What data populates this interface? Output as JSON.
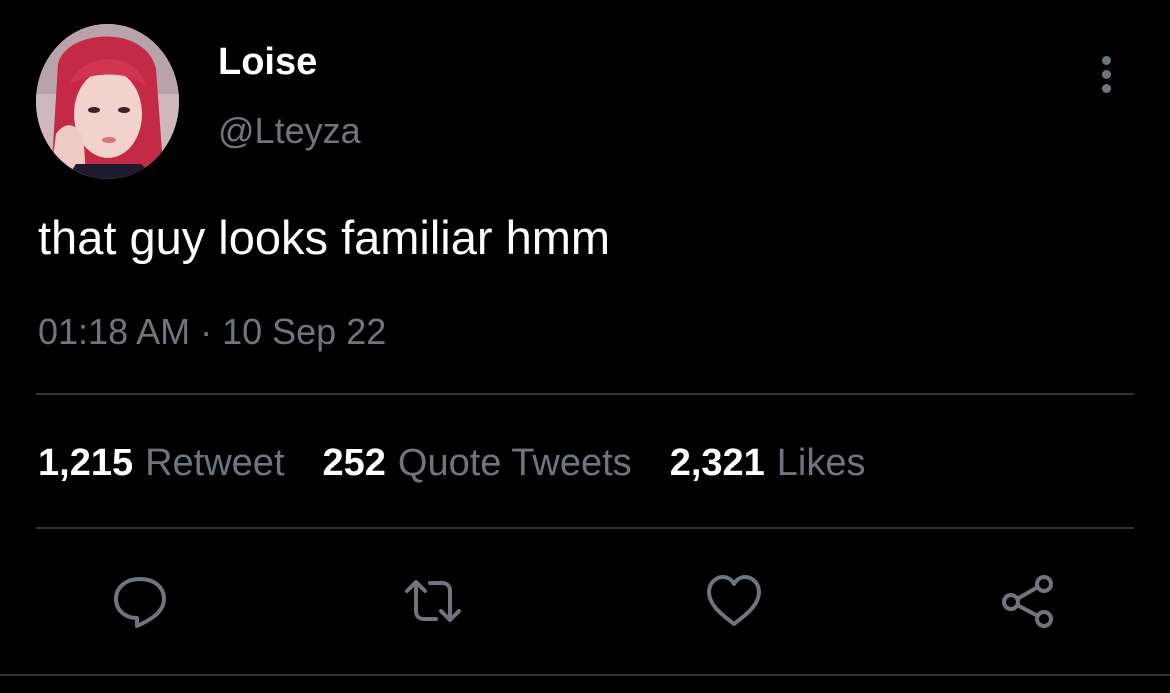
{
  "tweet": {
    "author": {
      "display_name": "Loise",
      "handle": "@Lteyza"
    },
    "text": "that guy looks familiar hmm",
    "timestamp": "01:18 AM · 10 Sep 22",
    "stats": [
      {
        "count": "1,215",
        "label": "Retweet"
      },
      {
        "count": "252",
        "label": "Quote Tweets"
      },
      {
        "count": "2,321",
        "label": "Likes"
      }
    ],
    "actions": [
      "reply-icon",
      "retweet-icon",
      "heart-icon",
      "share-icon"
    ]
  },
  "colors": {
    "background": "#000000",
    "primary_text": "#ffffff",
    "secondary_text": "#6e767d",
    "divider": "#2f3336"
  }
}
